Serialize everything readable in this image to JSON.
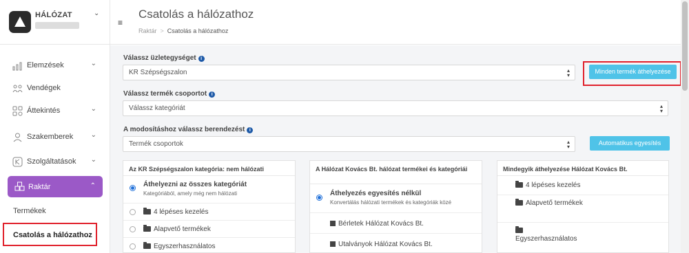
{
  "brand": {
    "name": "HÁLÓZAT"
  },
  "sidebar": {
    "items": [
      {
        "label": "Elemzések",
        "icon": "chart-icon"
      },
      {
        "label": "Vendégek",
        "icon": "users-icon"
      },
      {
        "label": "Áttekintés",
        "icon": "grid-icon"
      },
      {
        "label": "Szakemberek",
        "icon": "user-icon"
      },
      {
        "label": "Szolgáltatások",
        "icon": "service-icon"
      }
    ],
    "active": {
      "label": "Raktár",
      "icon": "warehouse-icon"
    },
    "sub_items": [
      "Termékek",
      "Csatolás a hálózathoz"
    ]
  },
  "header": {
    "title": "Csatolás a hálózathoz",
    "breadcrumb": [
      "Raktár",
      "Csatolás a hálózathoz"
    ]
  },
  "form": {
    "store_label": "Válassz üzletegységet",
    "store_value": "KR Szépségszalon",
    "move_all_button": "Minden termék áthelyezése",
    "group_label": "Válassz termék csoportot",
    "group_placeholder": "Válassz kategóriát",
    "device_label": "A modosításhoz válassz berendezést",
    "device_value": "Termék csoportok",
    "auto_merge_button": "Automatikus egyesítés"
  },
  "columns": {
    "left": {
      "header": "Az KR Szépségszalon kategória: nem hálózati",
      "rows": [
        {
          "label": "Áthelyezni az összes kategóriát",
          "sub": "Kategóriából, amely még nem hálózati",
          "selected": true
        },
        {
          "label": "4 lépéses kezelés"
        },
        {
          "label": "Alapvető termékek"
        },
        {
          "label": "Egyszerhasználatos"
        }
      ]
    },
    "middle": {
      "header": "A Hálózat Kovács Bt. hálózat termékei és kategóriái",
      "rows": [
        {
          "label": "Áthelyezés egyesítés nélkül",
          "sub": "Konvertálás hálózati termékek és kategóriák közé",
          "selected": true
        },
        {
          "label": "Bérletek Hálózat Kovács Bt."
        },
        {
          "label": "Utalványok Hálózat Kovács Bt."
        }
      ]
    },
    "right": {
      "header": "Mindegyik áthelyezése Hálózat Kovács Bt.",
      "rows": [
        {
          "label": "4 lépéses kezelés"
        },
        {
          "label": "Alapvető termékek"
        },
        {
          "label": "Egyszerhasználatos"
        }
      ]
    }
  },
  "colors": {
    "accent": "#9b59c7",
    "button": "#4fc3e8",
    "highlight": "#e0202b",
    "info": "#1e5aa8"
  }
}
